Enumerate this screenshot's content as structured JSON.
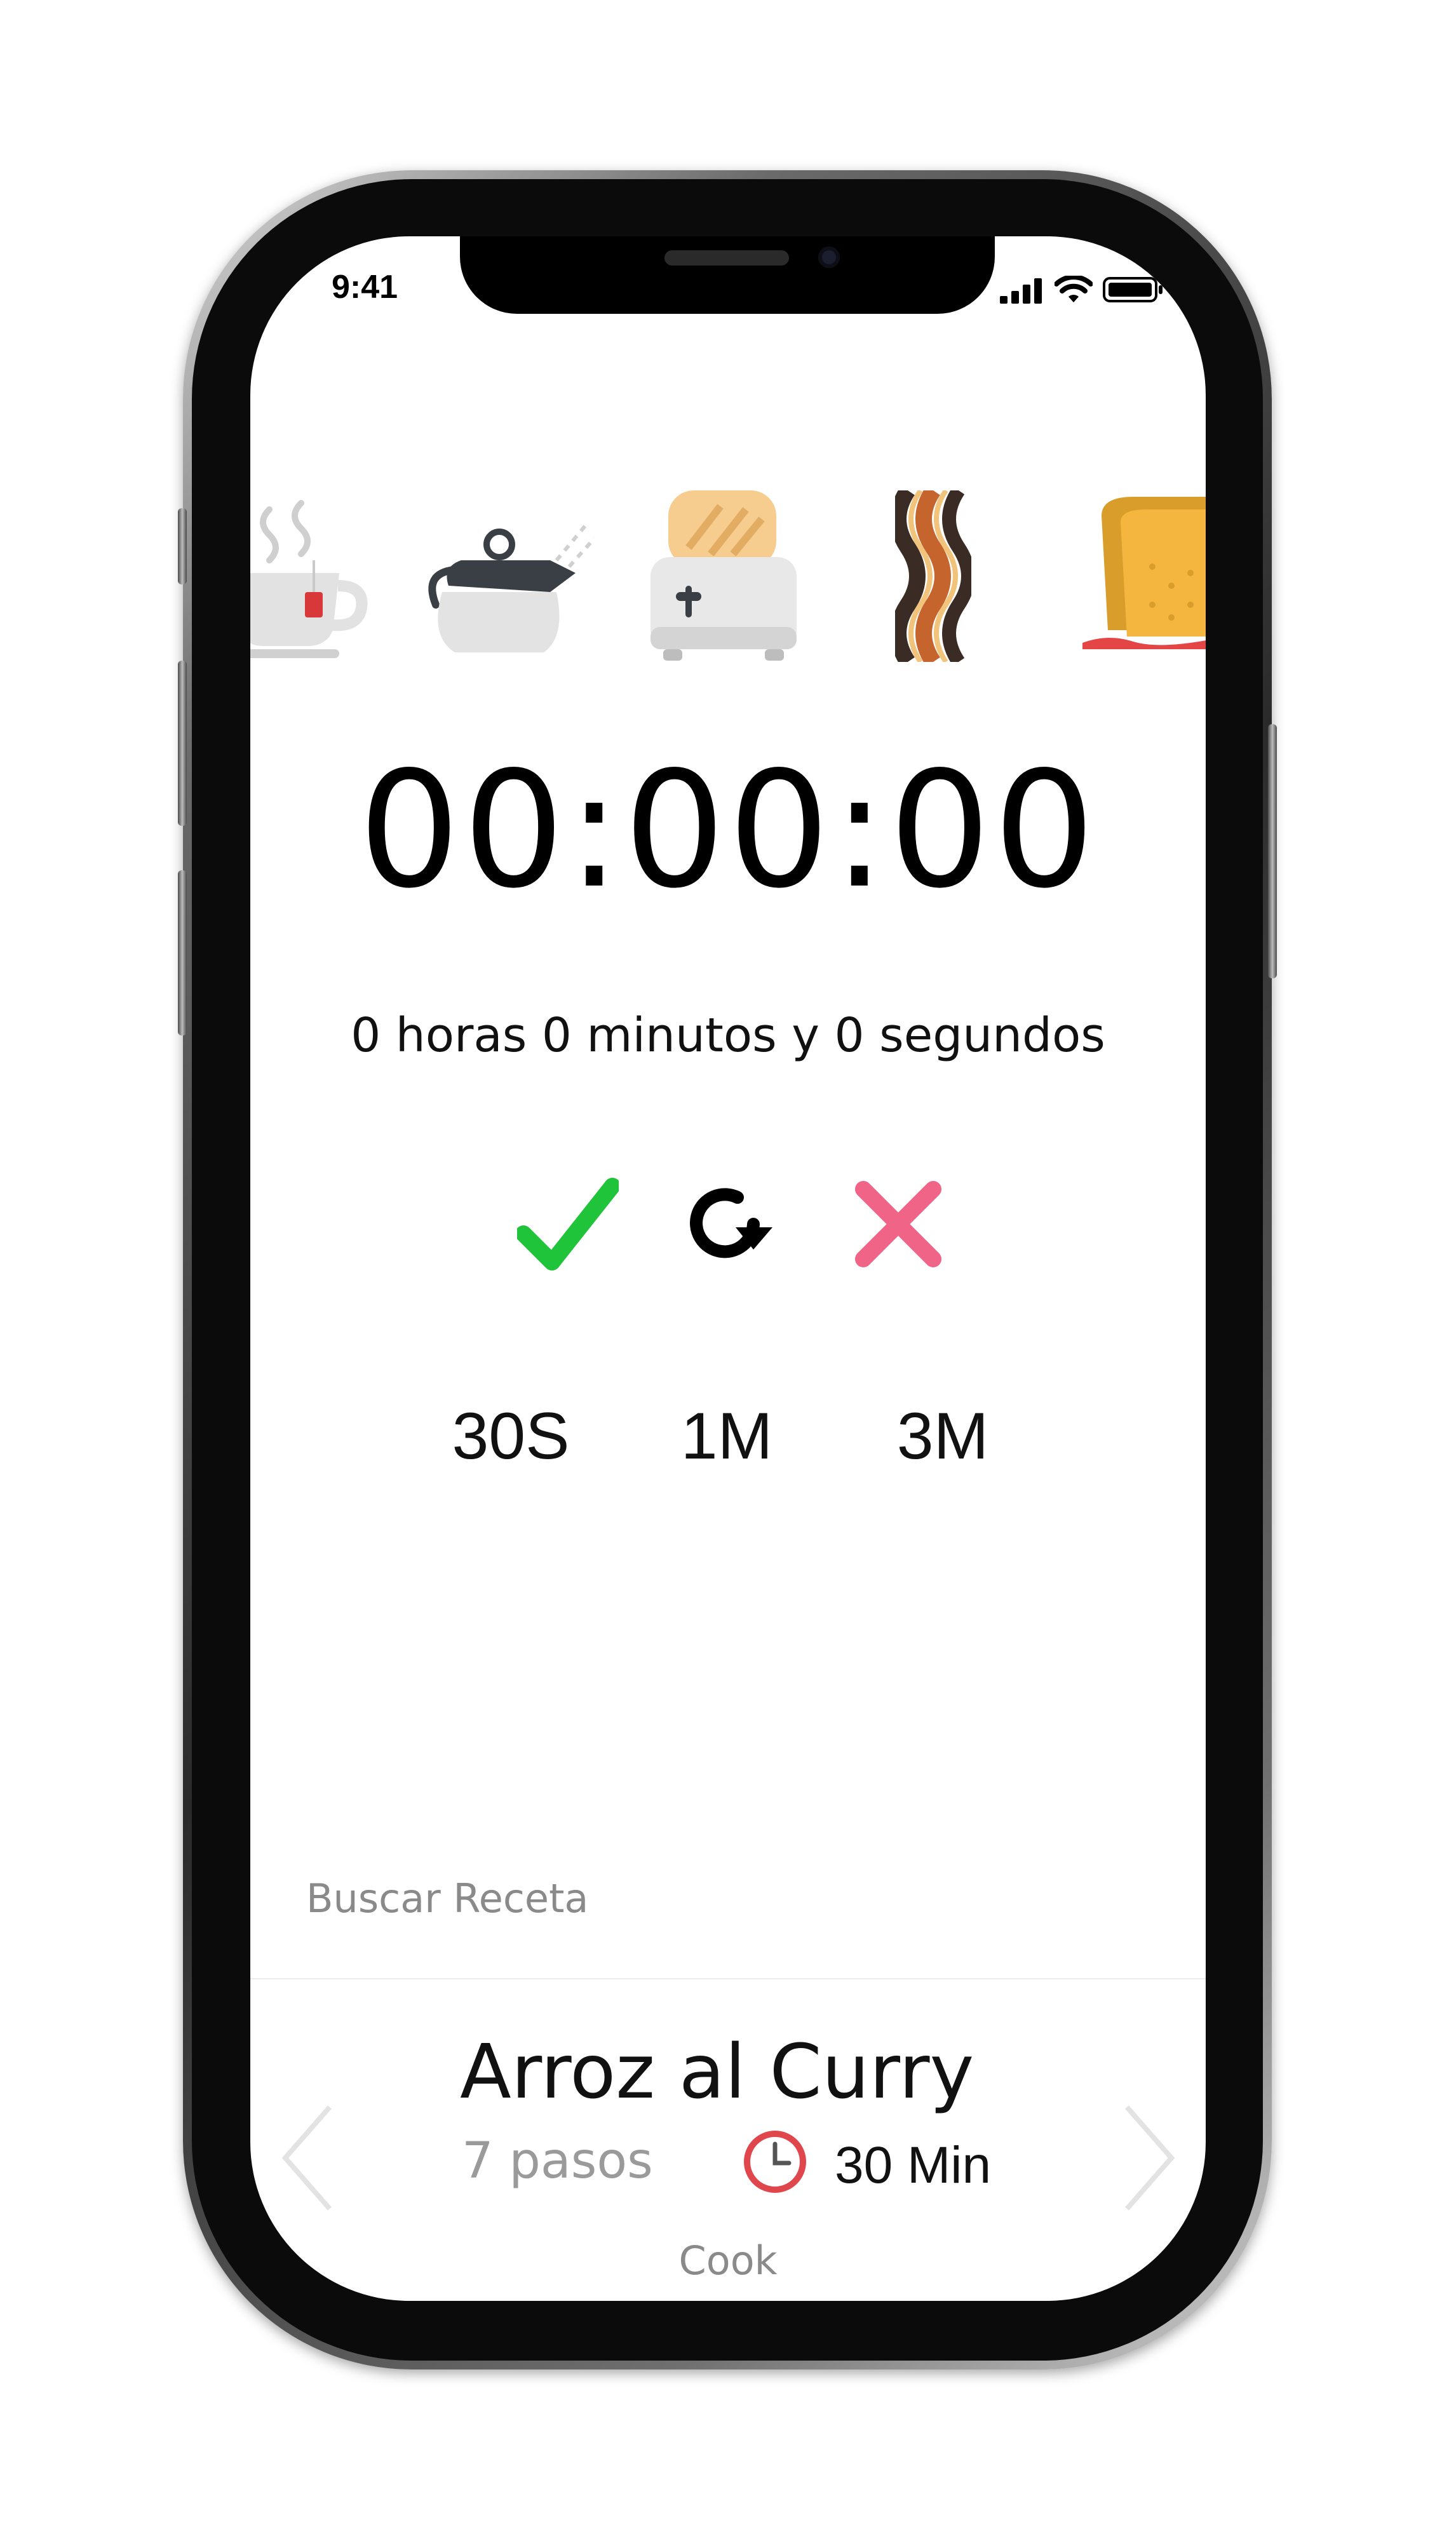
{
  "status": {
    "time": "9:41"
  },
  "food_icons": [
    "tea-cup",
    "kettle",
    "toaster",
    "bacon",
    "toast-bread"
  ],
  "timer": {
    "display": "00:00:00",
    "description": "0 horas 0 minutos y 0 segundos"
  },
  "controls": {
    "confirm_color": "#1fc43a",
    "cancel_color": "#f06488"
  },
  "presets": [
    "30S",
    "1M",
    "3M"
  ],
  "search": {
    "label": "Buscar Receta"
  },
  "recipe": {
    "title": "Arroz al Curry",
    "steps": "7 pasos",
    "time": "30 Min",
    "clock_color": "#e0474c"
  },
  "bottom": {
    "label": "Cook"
  }
}
